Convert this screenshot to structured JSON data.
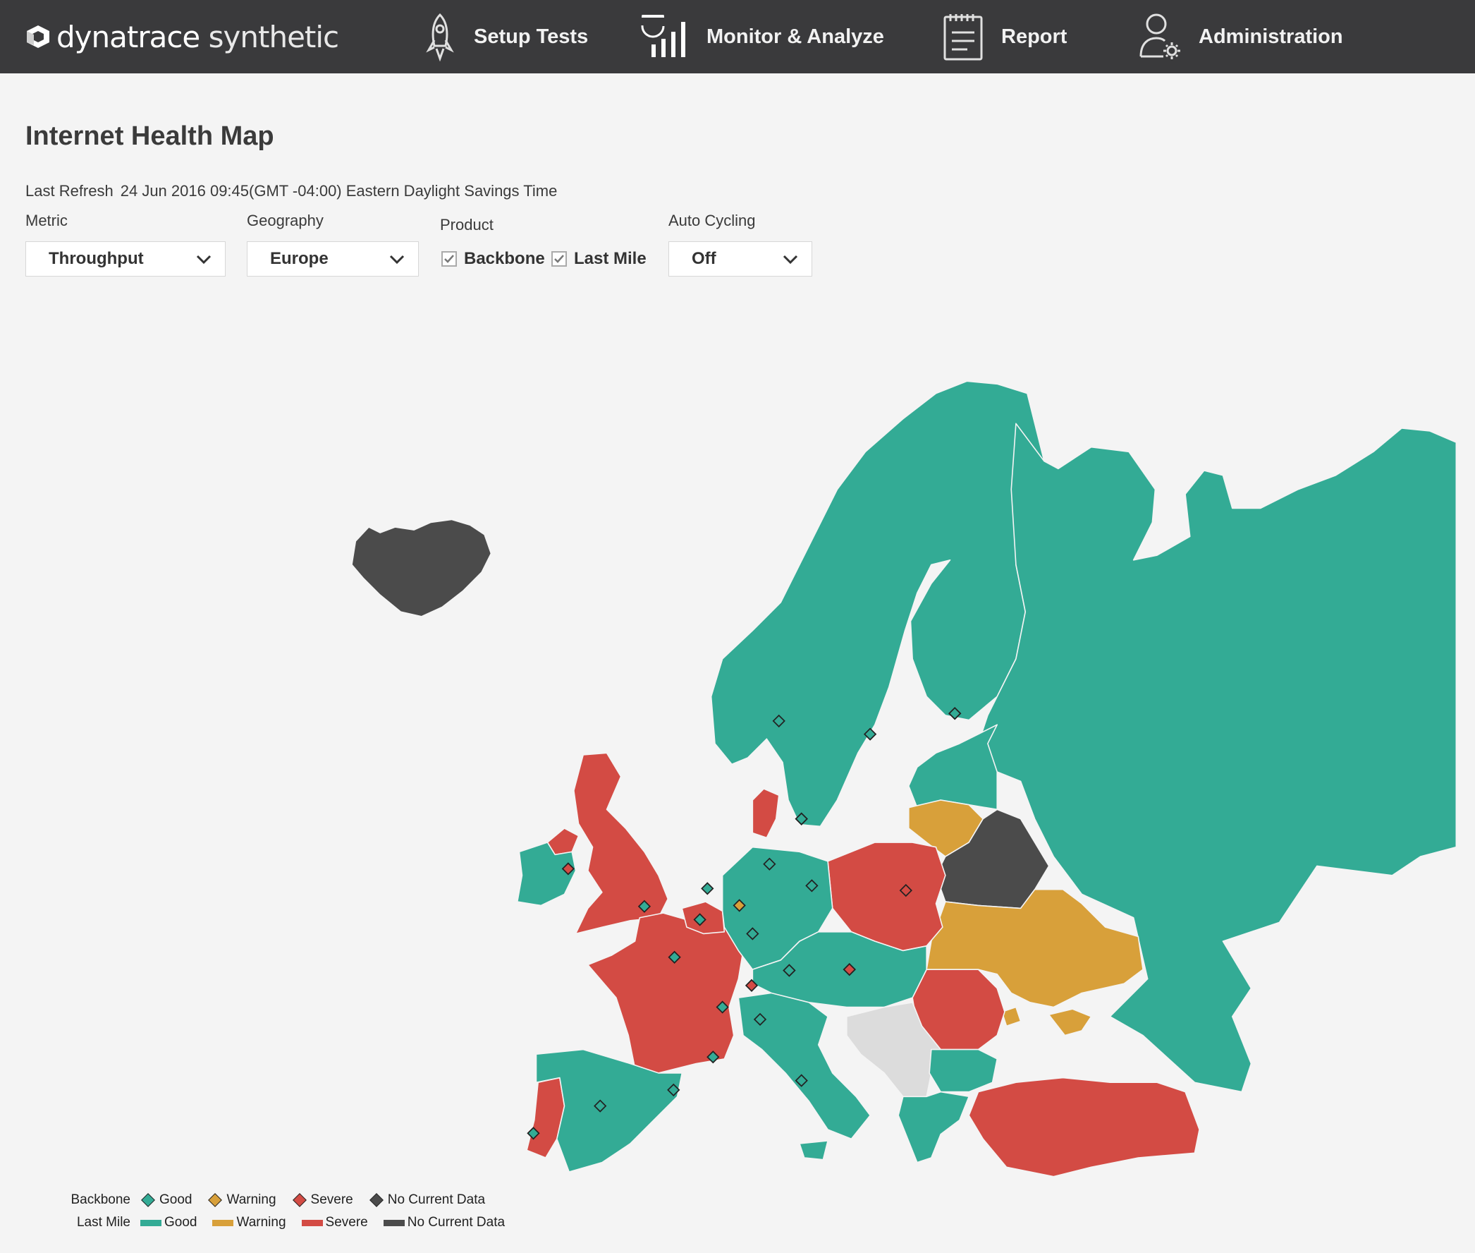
{
  "header": {
    "logo_brand": "dynatrace",
    "logo_product": "synthetic",
    "nav": [
      {
        "label": "Setup Tests",
        "icon": "rocket-icon"
      },
      {
        "label": "Monitor & Analyze",
        "icon": "bar-chart-icon"
      },
      {
        "label": "Report",
        "icon": "clipboard-icon"
      },
      {
        "label": "Administration",
        "icon": "user-gear-icon"
      }
    ]
  },
  "page": {
    "title": "Internet Health Map",
    "refresh_label": "Last Refresh",
    "refresh_value": "24 Jun 2016 09:45(GMT -04:00) Eastern Daylight Savings Time"
  },
  "controls": {
    "metric_label": "Metric",
    "metric_value": "Throughput",
    "geography_label": "Geography",
    "geography_value": "Europe",
    "product_label": "Product",
    "backbone_label": "Backbone",
    "backbone_checked": true,
    "lastmile_label": "Last Mile",
    "lastmile_checked": true,
    "autocycling_label": "Auto Cycling",
    "autocycling_value": "Off"
  },
  "colors": {
    "good": "#33ab95",
    "warning": "#d8a03a",
    "severe": "#d34b44",
    "no_data": "#4b4b4b",
    "unavailable": "#dcdcdc",
    "topbar": "#3a3a3c"
  },
  "legend": {
    "backbone_label": "Backbone",
    "lastmile_label": "Last Mile",
    "good": "Good",
    "warning": "Warning",
    "severe": "Severe",
    "no_data": "No Current Data"
  },
  "map": {
    "region_status": {
      "iceland": "no_data",
      "scandinavia": "good",
      "russia": "good",
      "baltics": "good",
      "lithuania": "warning",
      "belarus": "no_data",
      "ukraine": "warning",
      "crimea": "warning",
      "poland": "severe",
      "romania": "severe",
      "turkey": "severe",
      "uk": "severe",
      "northern-ireland": "severe",
      "ireland": "good",
      "france": "severe",
      "belgium": "severe",
      "denmark": "severe",
      "portugal": "severe",
      "spain": "good",
      "germany": "good",
      "central-europe": "good",
      "italy": "good",
      "balkans": "unavailable",
      "bulgaria": "good",
      "greece": "good"
    },
    "backbone_markers": [
      "good",
      "good",
      "good",
      "good",
      "good",
      "good",
      "severe",
      "good",
      "good",
      "good",
      "warning",
      "good",
      "good",
      "good",
      "severe",
      "severe",
      "good",
      "good",
      "good",
      "severe",
      "good",
      "good",
      "good",
      "good",
      "good",
      "good",
      "good",
      "severe"
    ]
  }
}
